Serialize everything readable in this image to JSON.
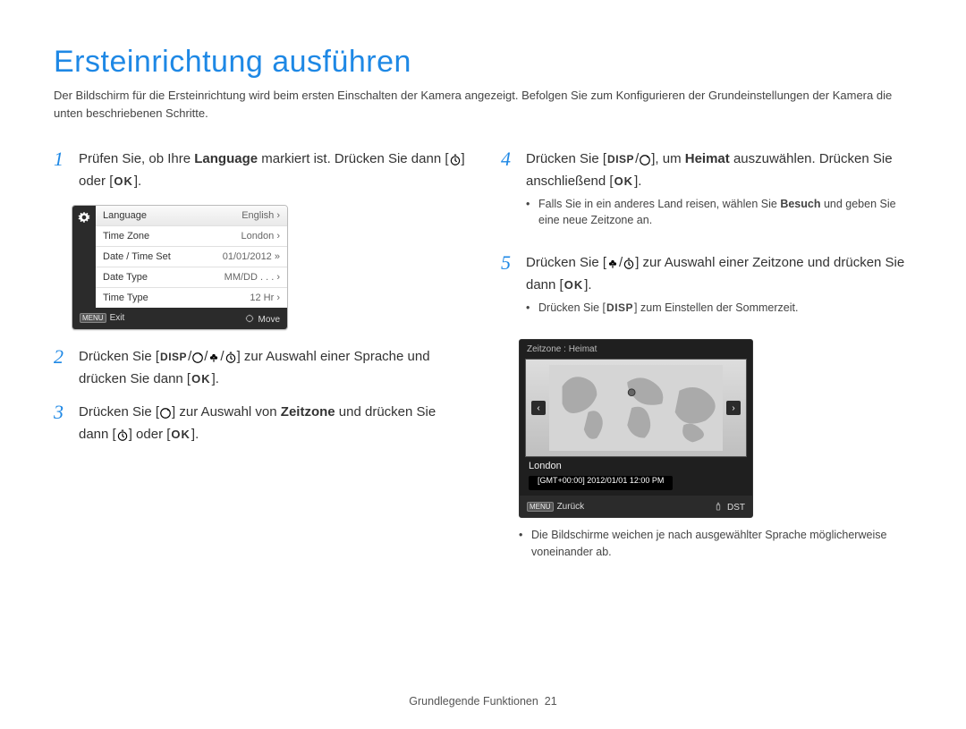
{
  "title": "Ersteinrichtung ausführen",
  "intro": "Der Bildschirm für die Ersteinrichtung wird beim ersten Einschalten der Kamera angezeigt. Befolgen Sie zum Konfigurieren der Grundeinstellungen der Kamera die unten beschriebenen Schritte.",
  "steps": {
    "s1": {
      "num": "1",
      "pre": "Prüfen Sie, ob Ihre ",
      "bold1": "Language",
      "mid": " markiert ist. Drücken Sie dann [",
      "after": "] oder [",
      "end": "]."
    },
    "s2": {
      "num": "2",
      "pre": "Drücken Sie [",
      "mid": "] zur Auswahl einer Sprache und drücken Sie dann [",
      "end": "]."
    },
    "s3": {
      "num": "3",
      "pre": "Drücken Sie [",
      "mid1": "] zur Auswahl von ",
      "bold": "Zeitzone",
      "mid2": " und drücken Sie dann [",
      "mid3": "] oder [",
      "end": "]."
    },
    "s4": {
      "num": "4",
      "pre": "Drücken Sie [",
      "mid1": "], um ",
      "bold": "Heimat",
      "mid2": " auszuwählen. Drücken Sie anschließend [",
      "end": "]."
    },
    "s4sub": {
      "pre": "Falls Sie in ein anderes Land reisen, wählen Sie ",
      "bold": "Besuch",
      "post": " und geben Sie eine neue Zeitzone an."
    },
    "s5": {
      "num": "5",
      "pre": "Drücken Sie [",
      "mid": "] zur Auswahl einer Zeitzone und drücken Sie dann [",
      "end": "]."
    },
    "s5sub1": {
      "pre": "Drücken Sie [",
      "post": "] zum Einstellen der Sommerzeit."
    },
    "s5sub2": "Die Bildschirme weichen je nach ausgewählter Sprache möglicherweise voneinander ab."
  },
  "icons": {
    "disp": "DISP",
    "ok": "OK",
    "menu": "MENU"
  },
  "cam_menu": {
    "rows": [
      {
        "label": "Language",
        "value": "English",
        "sel": true
      },
      {
        "label": "Time Zone",
        "value": "London"
      },
      {
        "label": "Date / Time Set",
        "value": "01/01/2012"
      },
      {
        "label": "Date Type",
        "value": "MM/DD . . ."
      },
      {
        "label": "Time Type",
        "value": "12 Hr"
      }
    ],
    "foot_left": "Exit",
    "foot_right": "Move"
  },
  "tz": {
    "title": "Zeitzone : Heimat",
    "city": "London",
    "gmt": "[GMT+00:00]  2012/01/01  12:00 PM",
    "foot_left": "Zurück",
    "foot_right": "DST"
  },
  "footer": {
    "section": "Grundlegende Funktionen",
    "page": "21"
  }
}
